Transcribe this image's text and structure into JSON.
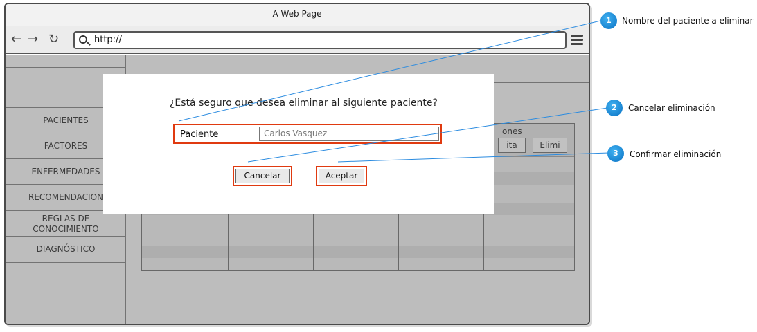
{
  "browser": {
    "title": "A Web Page",
    "url": "http://",
    "back_icon": "arrow-left-icon",
    "forward_icon": "arrow-right-icon",
    "reload_icon": "reload-icon",
    "search_icon": "search-icon",
    "menu_icon": "hamburger-menu-icon"
  },
  "sidebar": {
    "items": [
      {
        "label": "PACIENTES"
      },
      {
        "label": "FACTORES"
      },
      {
        "label": "ENFERMEDADES"
      },
      {
        "label": "RECOMENDACION"
      },
      {
        "label": "REGLAS DE CONOCIMIENTO"
      },
      {
        "label": "DIAGNÓSTICO"
      }
    ]
  },
  "table": {
    "header_partial": "ones",
    "edit_partial": "ita",
    "delete_partial": "Elimi"
  },
  "dialog": {
    "question": "¿Está seguro que desea eliminar al siguiente paciente?",
    "field_label": "Paciente",
    "field_value": "Carlos Vasquez",
    "cancel_label": "Cancelar",
    "accept_label": "Aceptar"
  },
  "annotations": [
    {
      "number": "1",
      "text": "Nombre del paciente a eliminar"
    },
    {
      "number": "2",
      "text": "Cancelar eliminación"
    },
    {
      "number": "3",
      "text": "Confirmar eliminación"
    }
  ],
  "colors": {
    "highlight": "#e03a10",
    "callout": "#0a72c4",
    "leader_line": "#2a8be0"
  }
}
